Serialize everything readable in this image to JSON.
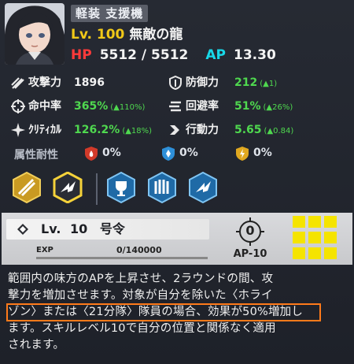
{
  "header": {
    "unit_type": "軽装 支援機",
    "level": "Lv. 100",
    "name": "無敵の龍",
    "hp_label": "HP",
    "hp_value": "5512 / 5512",
    "ap_label": "AP",
    "ap_value": "13.30"
  },
  "stats": {
    "attack": {
      "label": "攻撃力",
      "value": "1896"
    },
    "defense": {
      "label": "防御力",
      "value": "212",
      "bonus": "(▲1)"
    },
    "accuracy": {
      "label": "命中率",
      "value": "365%",
      "bonus": "(▲110%)"
    },
    "evasion": {
      "label": "回避率",
      "value": "51%",
      "bonus": "(▲26%)"
    },
    "critical": {
      "label": "ｸﾘﾃｨｶﾙ",
      "value": "126.2%",
      "bonus": "(▲18%)"
    },
    "action": {
      "label": "行動力",
      "value": "5.65",
      "bonus": "(▲0.84)"
    }
  },
  "resistance": {
    "label": "属性耐性",
    "fire": "0%",
    "ice": "0%",
    "electric": "0%"
  },
  "skill": {
    "level_label": "Lv.",
    "level_value": "10",
    "name": "号令",
    "exp_label": "EXP",
    "exp_value": "0/140000",
    "exp_progress": 0,
    "ap_cost_number": "0",
    "ap_cost_label": "AP-10",
    "description_lines": [
      "範囲内の味方のAPを上昇させ、2ラウンドの間、攻",
      "撃力を増加させます。対象が自分を除いた〈ホライ",
      "ゾン〉または〈21分隊〉隊員の場合、効果が50%増加し",
      "ます。スキルレベル10で自分の位置と関係なく適用",
      "されます。"
    ]
  },
  "colors": {
    "level": "#f0c818",
    "hp": "#ff3a3a",
    "ap": "#18d8e8",
    "bonus": "#4fd84f",
    "highlight": "#ff7a1a",
    "skill_grid": "#f5e400"
  },
  "icons": {
    "portrait": "character-portrait",
    "attack": "slash-icon",
    "defense": "shield-icon",
    "accuracy": "crosshair-icon",
    "evasion": "evasion-icon",
    "critical": "star-burst-icon",
    "action": "arrow-icon"
  }
}
